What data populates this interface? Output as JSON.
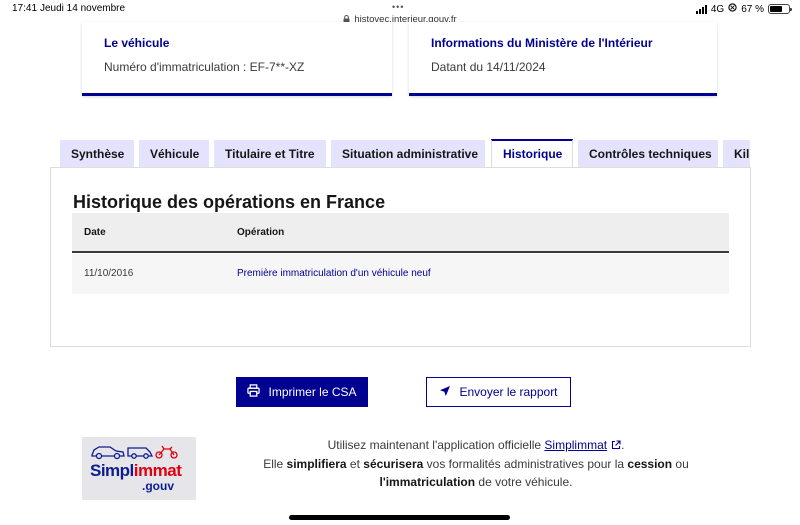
{
  "status_bar": {
    "time": "17:41",
    "date": "Jeudi 14 novembre",
    "dots": "•••",
    "url": "histovec.interieur.gouv.fr",
    "network": "4G",
    "battery": "67 %",
    "battery_level": 0.67
  },
  "cards": {
    "vehicle": {
      "title": "Le véhicule",
      "text": "Numéro d'immatriculation : EF-7**-XZ"
    },
    "ministry": {
      "title": "Informations du Ministère de l'Intérieur",
      "text": "Datant du 14/11/2024"
    }
  },
  "tabs": [
    {
      "label": "Synthèse",
      "active": false
    },
    {
      "label": "Véhicule",
      "active": false
    },
    {
      "label": "Titulaire et Titre",
      "active": false
    },
    {
      "label": "Situation administrative",
      "active": false
    },
    {
      "label": "Historique",
      "active": true
    },
    {
      "label": "Contrôles techniques",
      "active": false
    },
    {
      "label": "Kil",
      "active": false
    }
  ],
  "history": {
    "title": "Historique des opérations en France",
    "columns": [
      "Date",
      "Opération"
    ],
    "rows": [
      {
        "date": "11/10/2016",
        "operation": "Première immatriculation d'un véhicule neuf"
      }
    ]
  },
  "actions": {
    "print_label": "Imprimer le CSA",
    "send_label": "Envoyer le rapport"
  },
  "simplimmat": {
    "logo_main": "Simpl",
    "logo_accent": "immat",
    "logo_suffix": ".gouv",
    "line1_pre": "Utilisez maintenant l'application officielle ",
    "line1_link": "Simplimmat",
    "line1_post": ".",
    "line2_a": "Elle ",
    "line2_b": "simplifiera",
    "line2_c": " et ",
    "line2_d": "sécurisera",
    "line2_e": " vos formalités administratives pour la ",
    "line2_f": "cession",
    "line2_g": " ou",
    "line3_a": "l'immatriculation",
    "line3_b": " de votre véhicule."
  },
  "colors": {
    "primary": "#000091",
    "tab_bg": "#e3e3fd",
    "accent_red": "#e1000f"
  }
}
